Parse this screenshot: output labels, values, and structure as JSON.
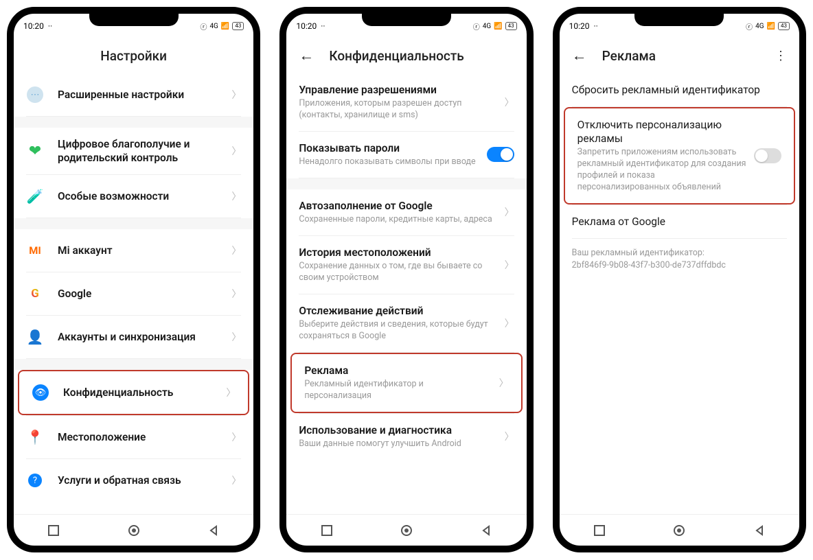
{
  "status": {
    "time": "10:20",
    "network": "4G",
    "battery": "43"
  },
  "screen1": {
    "title": "Настройки",
    "items": [
      {
        "key": "advanced",
        "label": "Расширенные настройки"
      },
      {
        "key": "wellbeing",
        "label": "Цифровое благополучие и родительский контроль"
      },
      {
        "key": "a11y",
        "label": "Особые возможности"
      },
      {
        "key": "mi",
        "label": "Mi аккаунт"
      },
      {
        "key": "google",
        "label": "Google"
      },
      {
        "key": "accounts",
        "label": "Аккаунты и синхронизация"
      },
      {
        "key": "privacy",
        "label": "Конфиденциальность"
      },
      {
        "key": "location",
        "label": "Местоположение"
      },
      {
        "key": "feedback",
        "label": "Услуги и обратная связь"
      }
    ]
  },
  "screen2": {
    "title": "Конфиденциальность",
    "perm": {
      "title": "Управление разрешениями",
      "sub": "Приложения, которым разрешен доступ (контакты, хранилище и sms)"
    },
    "passwords": {
      "title": "Показывать пароли",
      "sub": "Ненадолго показывать символы при вводе",
      "on": true
    },
    "autofill": {
      "title": "Автозаполнение от Google",
      "sub": "Сохраненные пароли, кредитные карты, адреса"
    },
    "history": {
      "title": "История местоположений",
      "sub": "Сохранение данных о том, где вы бываете со своим устройством"
    },
    "activity": {
      "title": "Отслеживание действий",
      "sub": "Выберите действия и сведения, которые будут сохраняться в Google"
    },
    "ads": {
      "title": "Реклама",
      "sub": "Рекламный идентификатор и персонализация"
    },
    "diag": {
      "title": "Использование и диагностика",
      "sub": "Ваши данные помогут улучшить Android"
    }
  },
  "screen3": {
    "title": "Реклама",
    "reset": {
      "title": "Сбросить рекламный идентификатор"
    },
    "disable": {
      "title": "Отключить персонализацию рекламы",
      "sub": "Запретить приложениям использовать рекламный идентификатор для создания профилей и показа персонализированных объявлений",
      "on": false
    },
    "google": {
      "title": "Реклама от Google"
    },
    "info": "Ваш рекламный идентификатор:\n2bf846f9-9b08-43f7-b300-de737dffdbdc"
  }
}
